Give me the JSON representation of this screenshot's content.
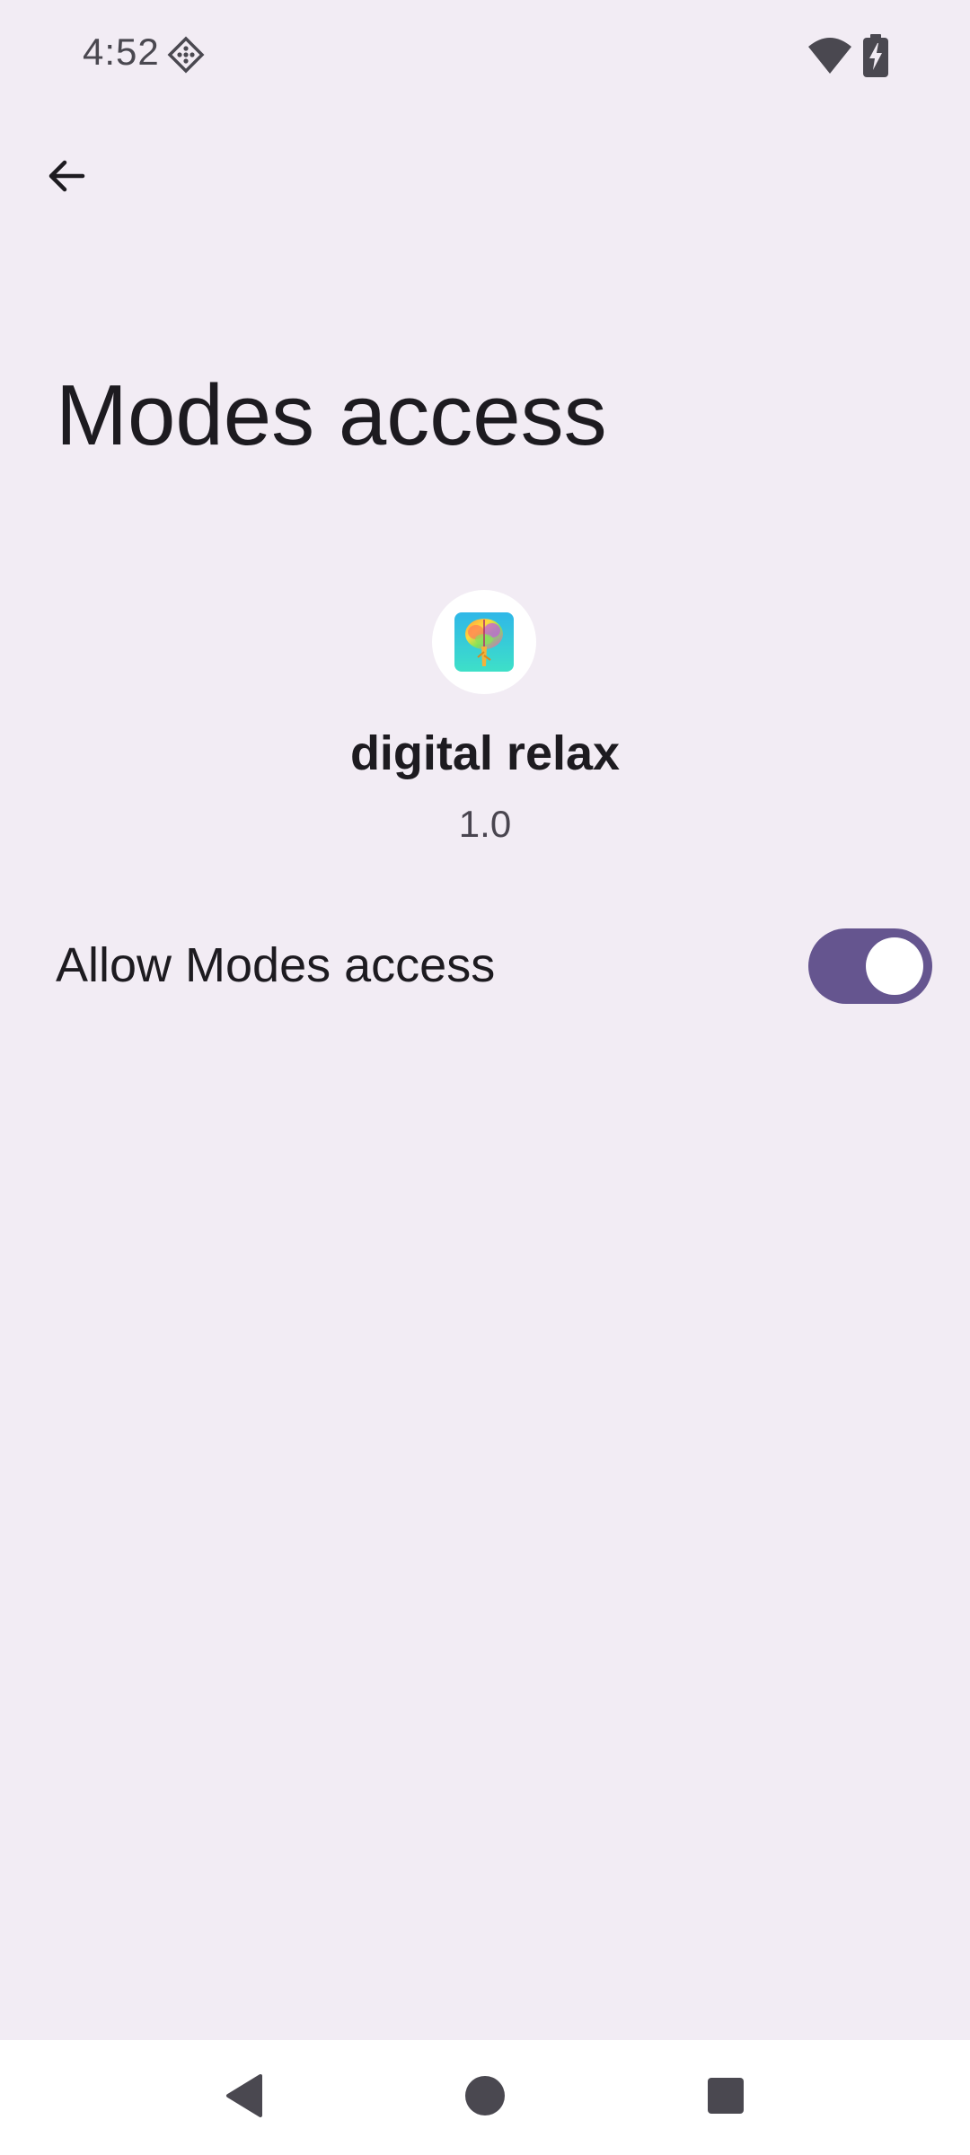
{
  "status_bar": {
    "time": "4:52",
    "icons": [
      "diamond-notification-icon",
      "wifi-icon",
      "battery-charging-icon"
    ]
  },
  "header": {
    "back_icon": "arrow-left-icon",
    "title": "Modes access"
  },
  "app": {
    "icon": "brain-tree-app-icon",
    "name": "digital relax",
    "version": "1.0"
  },
  "setting": {
    "label": "Allow Modes access",
    "enabled": true
  },
  "nav_bar": {
    "icons": [
      "nav-back-triangle-icon",
      "nav-home-circle-icon",
      "nav-recents-square-icon"
    ]
  },
  "colors": {
    "background": "#f2ecf4",
    "switch_on": "#65558f",
    "text_primary": "#1d1b20",
    "text_secondary": "#49454f"
  }
}
